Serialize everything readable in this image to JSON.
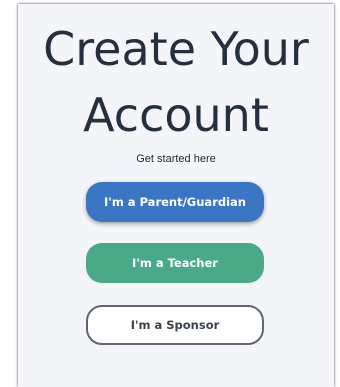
{
  "header": {
    "title_line1": "Create Your",
    "title_line2": "Account",
    "subtitle": "Get started here"
  },
  "buttons": {
    "parent_label": "I'm a Parent/Guardian",
    "teacher_label": "I'm a Teacher",
    "sponsor_label": "I'm a Sponsor"
  },
  "colors": {
    "parent_button": "#3b76c4",
    "teacher_button": "#4aa987",
    "sponsor_border": "#5f6672",
    "card_background": "#f3f5f8",
    "title_text": "#262f3e"
  }
}
